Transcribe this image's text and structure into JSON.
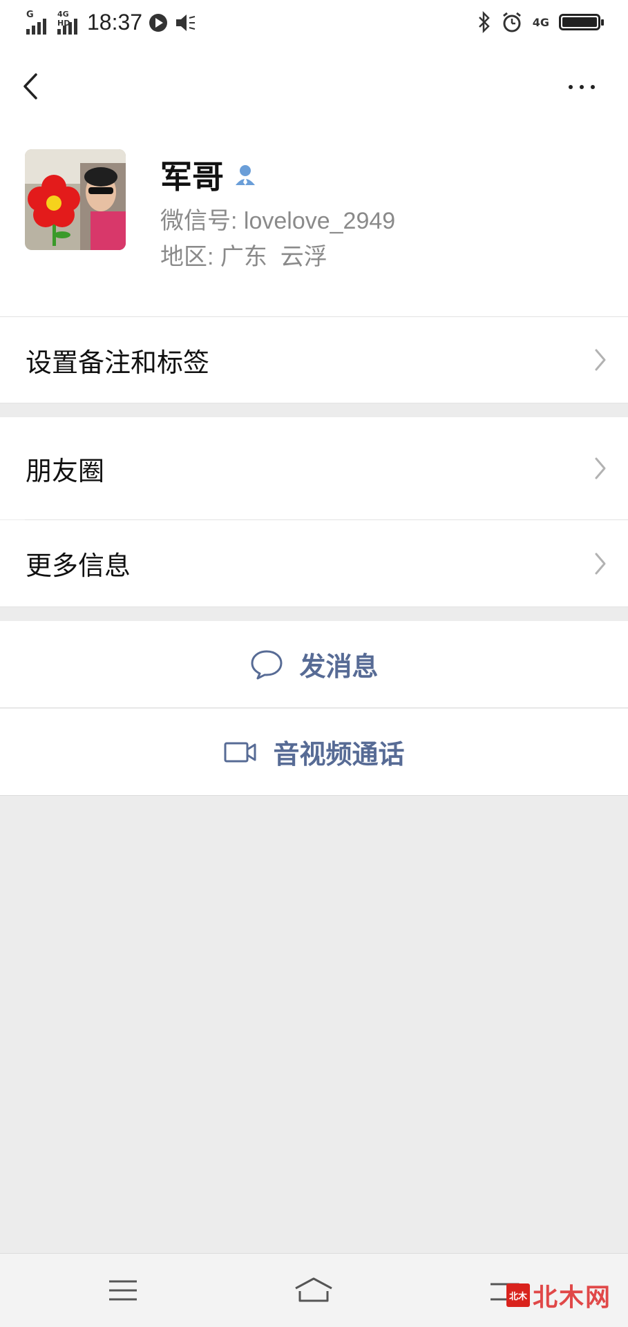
{
  "status_bar": {
    "signal1_label": "G",
    "signal2_label": "4G HD",
    "time": "18:37",
    "network_right": "4G"
  },
  "nav": {
    "back_icon": "chevron-left-icon",
    "more_icon": "more-dots-icon"
  },
  "profile": {
    "name": "军哥",
    "wechat_id_label": "微信号:",
    "wechat_id": "lovelove_2949",
    "region_label": "地区:",
    "region": "广东  云浮"
  },
  "menu": {
    "remark_tags": "设置备注和标签",
    "moments": "朋友圈",
    "more_info": "更多信息"
  },
  "actions": {
    "send_message": "发消息",
    "video_call": "音视频通话"
  },
  "watermark": {
    "logo_text": "北木",
    "text": "北木网"
  },
  "colors": {
    "accent": "#576b95",
    "page_bg": "#ececec"
  }
}
